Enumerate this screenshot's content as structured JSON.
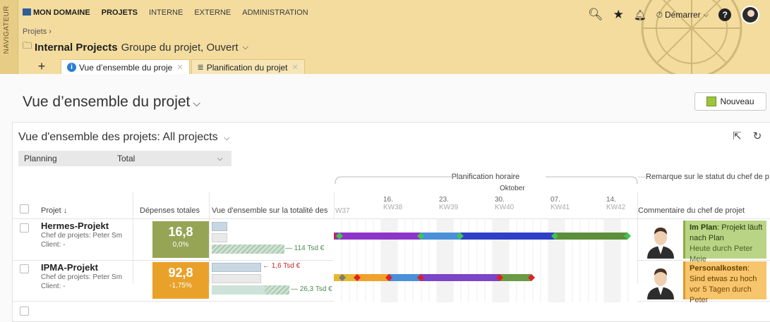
{
  "nav": {
    "label": "NAVIGATEUR"
  },
  "topmenu": [
    "MON DOMAINE",
    "PROJETS",
    "INTERNE",
    "EXTERNE",
    "ADMINISTRATION"
  ],
  "breadcrumb": "Projets ›",
  "title": {
    "name": "Internal Projects",
    "subtitle": "Groupe du projet, Ouvert"
  },
  "header_right": {
    "start_label": "Démarrer"
  },
  "tabs": [
    {
      "label": "Vue d’ensemble du proje"
    },
    {
      "label": "Planification du projet"
    }
  ],
  "page": {
    "title": "Vue d’ensemble du projet",
    "new_button": "Nouveau"
  },
  "card": {
    "title": "Vue d'ensemble des projets: All projects",
    "filter_left": "Planning",
    "filter_right": "Total"
  },
  "columns": {
    "project": "Projet",
    "costs": "Dépenses totales",
    "overview": "Vue d'ensemble sur la totalité des",
    "timeline_group": "Planification horaire",
    "status_group": "Remarque sur le statut du chef de p",
    "comment": "Commentaire du chef de projet",
    "month": "Oktober"
  },
  "weeks": [
    {
      "day": "",
      "kw": "W37"
    },
    {
      "day": "16.",
      "kw": "KW38"
    },
    {
      "day": "23.",
      "kw": "KW39"
    },
    {
      "day": "30.",
      "kw": "KW40"
    },
    {
      "day": "07.",
      "kw": "KW41"
    },
    {
      "day": "14.",
      "kw": "KW42"
    }
  ],
  "rows": [
    {
      "name": "Hermes-Projekt",
      "manager": "Chef de projets:  Peter Sm",
      "client": "Client:  -",
      "cost_value": "16,8",
      "cost_pct": "0,0%",
      "cost_color": "#96a455",
      "budget_label": "114 Tsd €",
      "comment_title": "Im Plan",
      "comment_text": ": Projekt läuft nach Plan",
      "comment_meta": "Heute durch Peter Meie",
      "comment_color": "#b9d485"
    },
    {
      "name": "IPMA-Projekt",
      "manager": "Chef de projets:  Peter Sm",
      "client": "Client:  -",
      "cost_value": "92,8",
      "cost_pct": "-1,75%",
      "cost_color": "#e9a12a",
      "over_label": "1,6 Tsd €",
      "budget_label": "26,3 Tsd €",
      "comment_title": "Personalkosten",
      "comment_text": ": Sind etwas zu hoch",
      "comment_meta": "vor 5 Tagen durch Peter",
      "comment_color": "#f6c56c"
    }
  ]
}
